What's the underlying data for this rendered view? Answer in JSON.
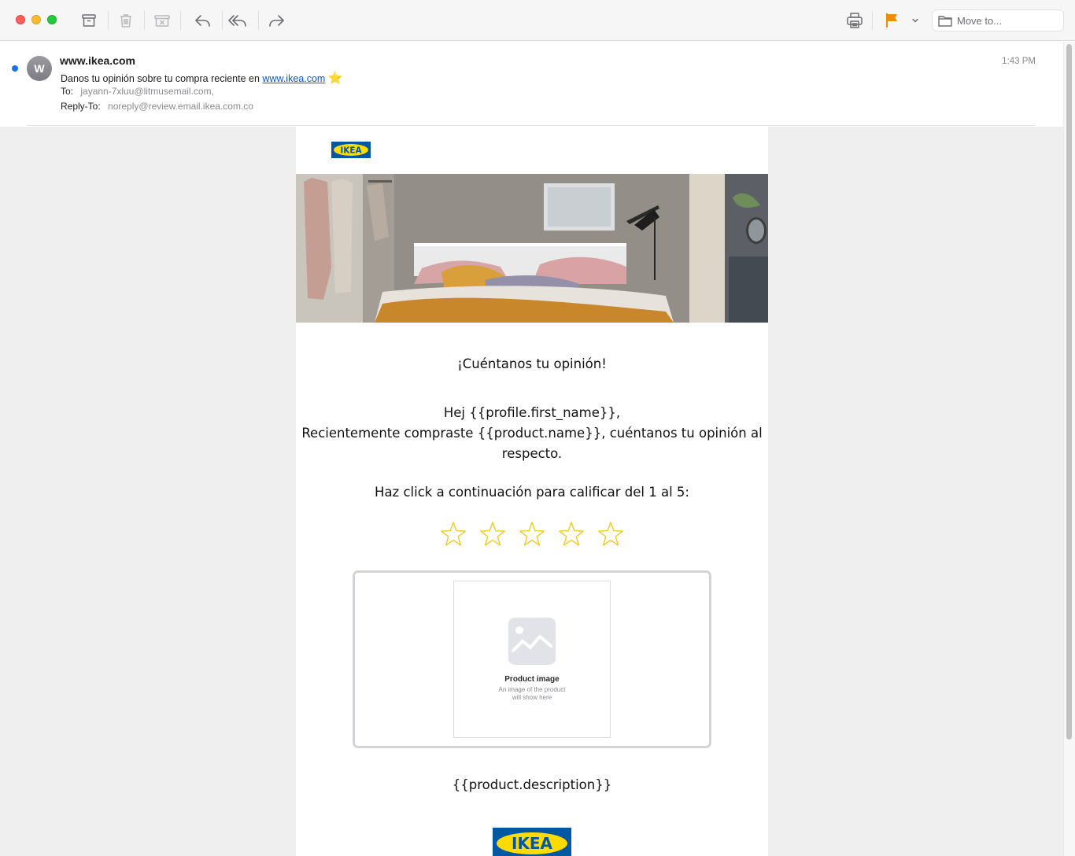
{
  "toolbar": {
    "buttons": [
      "archive-icon",
      "trash-icon",
      "junk-icon",
      "reply-icon",
      "reply-all-icon",
      "forward-icon",
      "print-icon",
      "flag-icon",
      "chevron-down-icon"
    ],
    "flag_color": "#f08c00",
    "move_to": {
      "label": "Move to..."
    }
  },
  "message": {
    "unread": true,
    "avatar_initial": "W",
    "sender": "www.ikea.com",
    "subject_prefix": "Danos tu opinión sobre tu compra reciente en",
    "subject_link": "www.ikea.com",
    "subject_emoji": "⭐",
    "to_label": "To:",
    "to_value": "jayann-7xluu@litmusemail.com,",
    "reply_to_label": "Reply-To:",
    "reply_to_value": "noreply@review.email.ikea.com.co",
    "time": "1:43 PM"
  },
  "email": {
    "logo_text": "IKEA",
    "brand_colors": {
      "blue": "#0058a3",
      "yellow": "#ffdb00"
    },
    "heading": "¡Cuéntanos tu opinión!",
    "greeting": "Hej {{profile.first_name}},",
    "body_line1": "Recientemente compraste {{product.name}}, cuéntanos tu opinión al",
    "body_line2": "respecto.",
    "instruction": "Haz click a continuación para calificar del 1 al 5:",
    "rating": {
      "max": 5,
      "selected": 0,
      "star_color": "#f2c80f"
    },
    "product_placeholder": {
      "title": "Product image",
      "subtitle_line1": "An image of the product",
      "subtitle_line2": "will show here"
    },
    "description": "{{product.description}}"
  }
}
